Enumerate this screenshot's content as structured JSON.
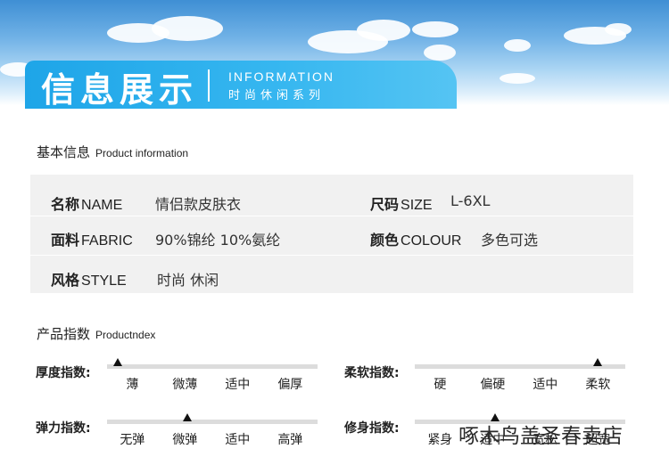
{
  "banner": {
    "title_cn": "信息展示",
    "title_en": "INFORMATION",
    "title_sub": "时尚休闲系列"
  },
  "basic_info": {
    "heading_cn": "基本信息",
    "heading_en": "Product information",
    "rows": [
      [
        {
          "key_cn": "名称",
          "key_en": "NAME",
          "value": "情侣款皮肤衣"
        },
        {
          "key_cn": "尺码",
          "key_en": "SIZE",
          "value": "L-6XL"
        }
      ],
      [
        {
          "key_cn": "面料",
          "key_en": "FABRIC",
          "value": "90%锦纶 10%氨纶"
        },
        {
          "key_cn": "颜色",
          "key_en": "COLOUR",
          "value": "多色可选"
        }
      ],
      [
        {
          "key_cn": "风格",
          "key_en": "STYLE",
          "value": "时尚 休闲"
        }
      ]
    ]
  },
  "product_index": {
    "heading_cn": "产品指数",
    "heading_en": "Productndex",
    "indices": [
      {
        "label": "厚度指数:",
        "options": [
          "薄",
          "微薄",
          "适中",
          "偏厚"
        ],
        "selected_position": 0.05
      },
      {
        "label": "柔软指数:",
        "options": [
          "硬",
          "偏硬",
          "适中",
          "柔软"
        ],
        "selected_position": 0.87
      },
      {
        "label": "弹力指数:",
        "options": [
          "无弹",
          "微弹",
          "适中",
          "高弹"
        ],
        "selected_position": 0.38
      },
      {
        "label": "修身指数:",
        "options": [
          "紧身",
          "适中",
          "宽松",
          "超宽"
        ],
        "selected_position": 0.38
      }
    ]
  },
  "watermark": "啄木鸟盖圣春卖店",
  "colors": {
    "title_tab": "#1ea5e8",
    "info_bg": "#f1f1f1",
    "track": "#dcdcdc"
  }
}
